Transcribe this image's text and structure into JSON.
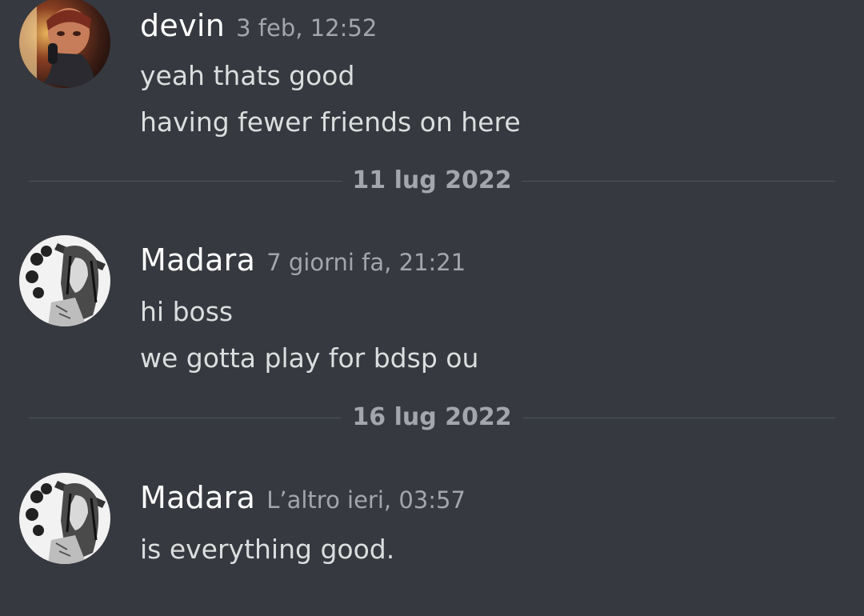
{
  "messages": [
    {
      "username": "devin",
      "timestamp": "3 feb, 12:52",
      "lines": [
        "yeah thats good",
        "having fewer friends on here"
      ]
    },
    {
      "username": "Madara",
      "timestamp": "7 giorni fa, 21:21",
      "lines": [
        "hi boss",
        "we gotta play for bdsp ou"
      ]
    },
    {
      "username": "Madara",
      "timestamp": "L’altro ieri, 03:57",
      "lines": [
        "is everything good."
      ]
    }
  ],
  "dividers": [
    "11 lug 2022",
    "16 lug 2022"
  ],
  "colors": {
    "background": "#36393f",
    "username": "#ffffff",
    "message_text": "#dcddde",
    "muted": "#a3a6aa",
    "divider_rule": "#4f545c"
  }
}
